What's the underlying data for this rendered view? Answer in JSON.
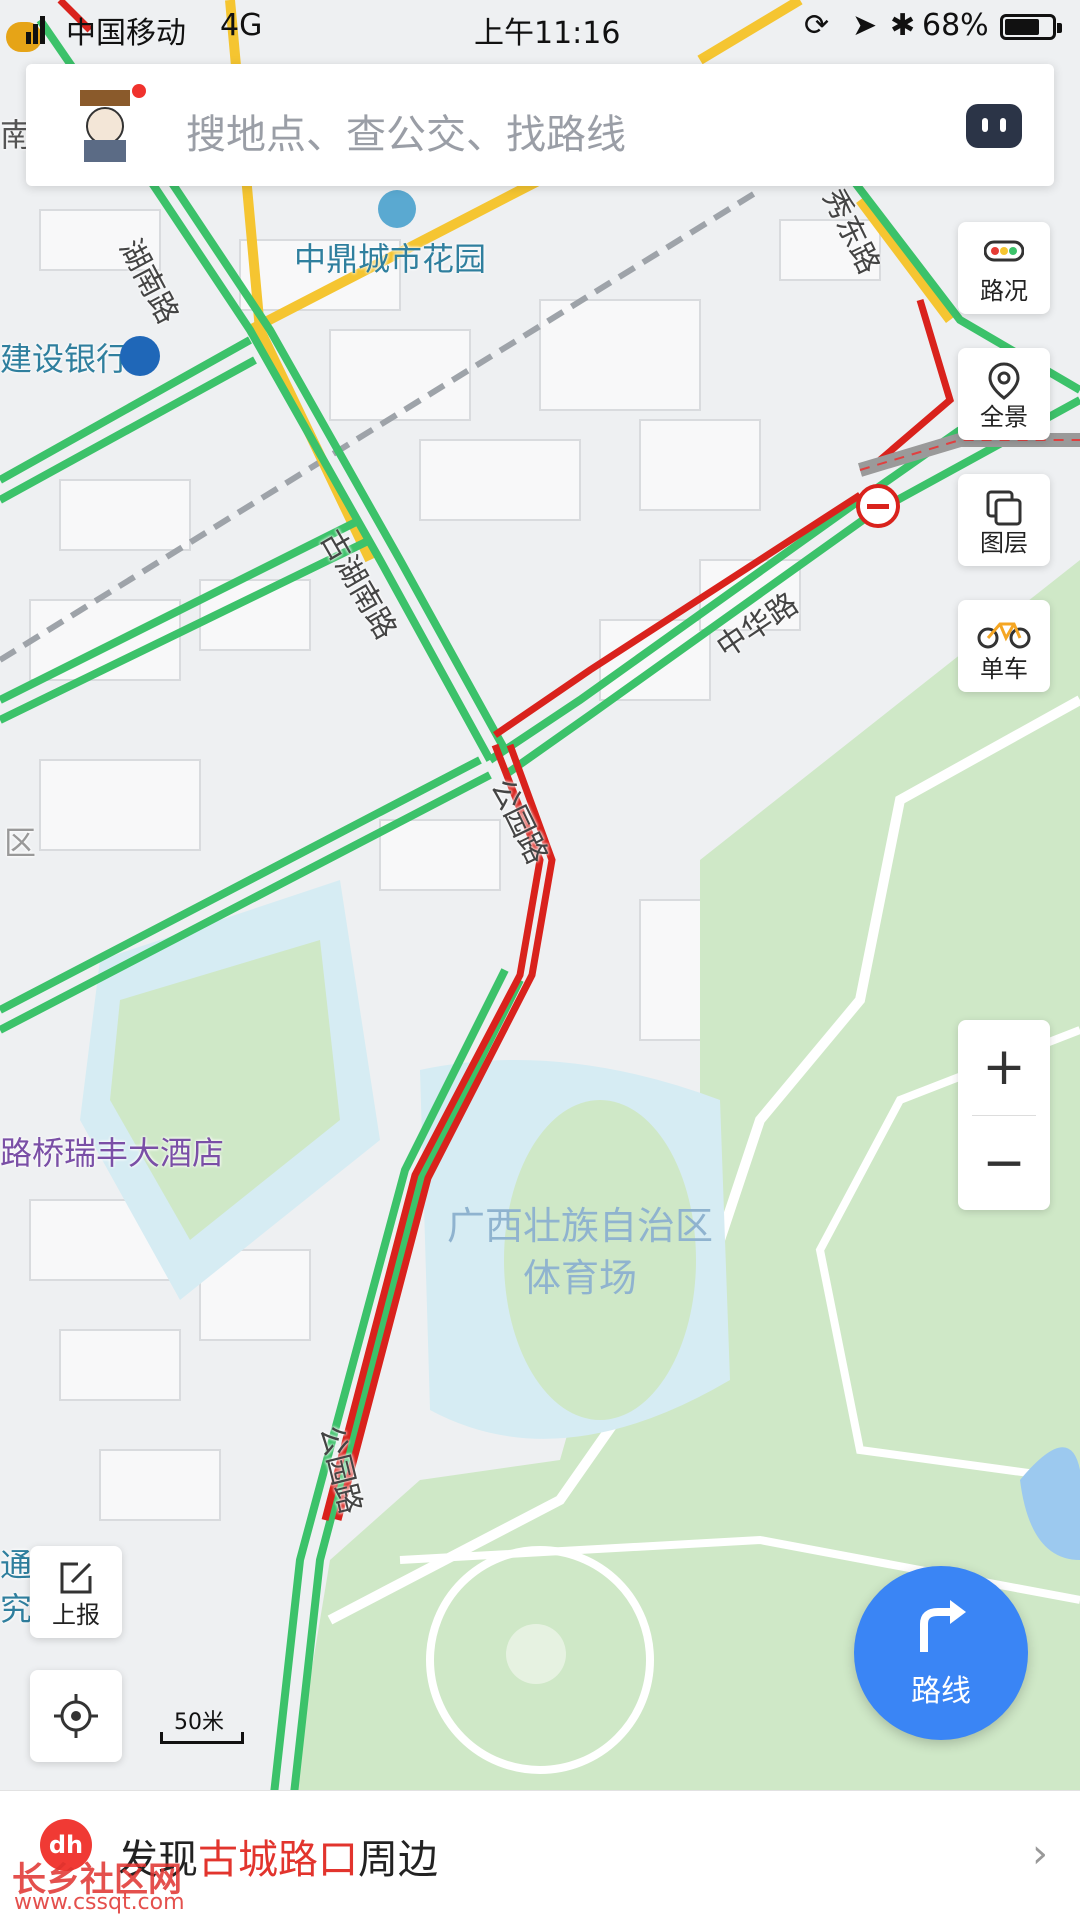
{
  "status_bar": {
    "carrier": "中国移动",
    "network": "4G",
    "time": "上午11:16",
    "battery": "68%"
  },
  "search": {
    "placeholder": "搜地点、查公交、找路线"
  },
  "tools": {
    "traffic": "路况",
    "overview": "全景",
    "layers": "图层",
    "bike": "单车"
  },
  "zoom": {
    "in": "+",
    "out": "−"
  },
  "left_tools": {
    "report": "上报"
  },
  "scale": {
    "label": "50米"
  },
  "route_button": {
    "label": "路线"
  },
  "bottom_bar": {
    "prefix": "发现",
    "highlight": "古城路口",
    "suffix": "周边",
    "badge": "dh"
  },
  "watermark": {
    "title": "长乡社区网",
    "url": "www.cssqt.com"
  },
  "map_labels": {
    "zhongding": "中鼎城市花园",
    "bank": "建设银行",
    "hotel": "路桥瑞丰大酒店",
    "stadium_line1": "广西壮族自治区",
    "stadium_line2": "体育场",
    "district": "区",
    "left_edge1": "通",
    "left_edge2": "究",
    "left_top": "南"
  },
  "road_labels": {
    "huhu_nan_top": "湖南路",
    "huhu_nan_mid": "古湖南路",
    "zhonghua": "中华路",
    "gongyuan_top": "公园路",
    "gongyuan_bottom": "公园路",
    "xiudong": "秀东路"
  },
  "colors": {
    "accent_blue": "#3a85f5",
    "traffic_green": "#3cc26a",
    "traffic_red": "#d9221c",
    "traffic_yellow": "#f5c531",
    "park_green": "#cfe8c7",
    "water": "#d6ecf3",
    "highlight_red": "#e2342d"
  },
  "icons": {
    "traffic": "traffic-light-icon",
    "overview": "location-pin-icon",
    "layers": "layers-icon",
    "bike": "bicycle-icon",
    "report": "edit-icon",
    "locate": "locate-icon",
    "route": "turn-arrow-icon",
    "assistant": "robot-icon",
    "no_entry": "no-entry-icon",
    "bank": "bank-logo-icon",
    "poi": "building-poi-icon"
  }
}
